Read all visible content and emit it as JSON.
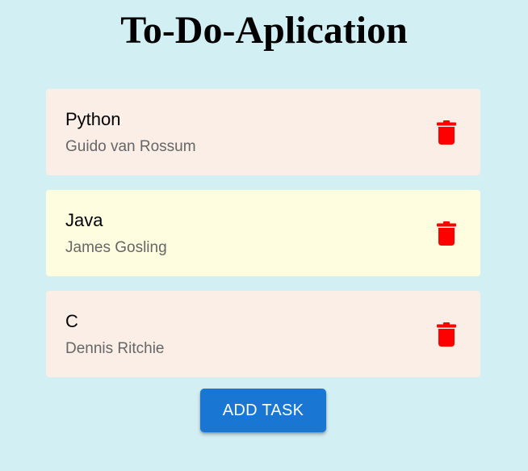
{
  "app": {
    "title": "To-Do-Aplication"
  },
  "colors": {
    "background": "#d2eff4",
    "delete_icon": "#ff0000",
    "add_button": "#1976d2"
  },
  "tasks": [
    {
      "title": "Python",
      "author": "Guido van Rossum",
      "background": "#faeee6",
      "icon": "trash-icon"
    },
    {
      "title": "Java",
      "author": "James Gosling",
      "background": "#fffde0",
      "icon": "trash-icon"
    },
    {
      "title": "C",
      "author": "Dennis Ritchie",
      "background": "#faeee6",
      "icon": "trash-icon"
    }
  ],
  "actions": {
    "add_label": "ADD TASK"
  }
}
